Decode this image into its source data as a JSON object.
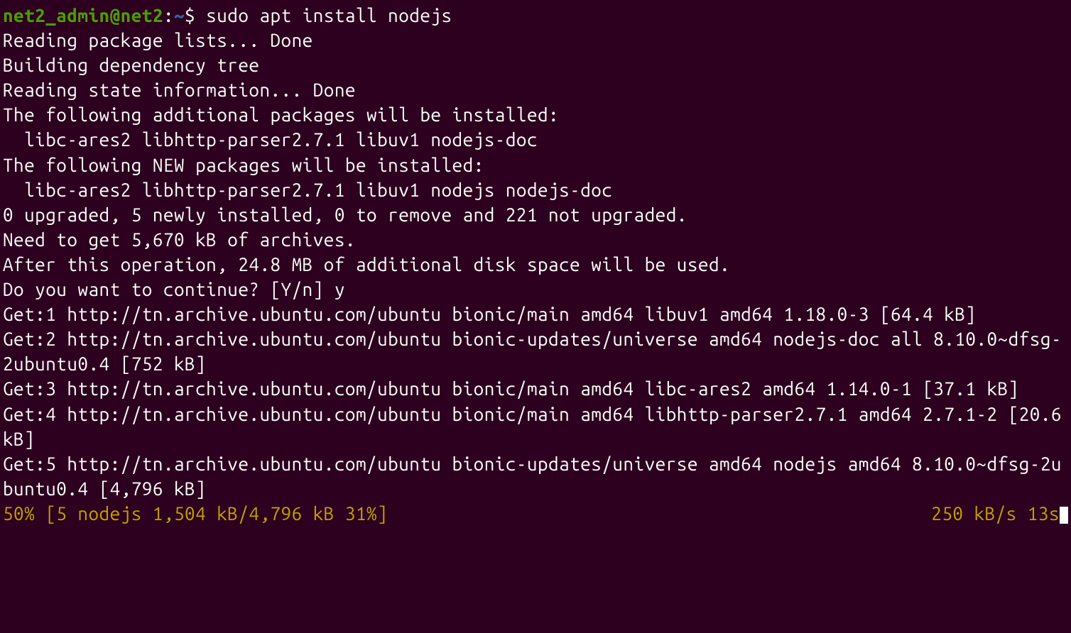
{
  "prompt": {
    "user_host": "net2_admin@net2",
    "separator": ":",
    "path": "~",
    "dollar": "$ "
  },
  "command": "sudo apt install nodejs",
  "output_lines": [
    "Reading package lists... Done",
    "Building dependency tree",
    "Reading state information... Done",
    "The following additional packages will be installed:",
    "  libc-ares2 libhttp-parser2.7.1 libuv1 nodejs-doc",
    "The following NEW packages will be installed:",
    "  libc-ares2 libhttp-parser2.7.1 libuv1 nodejs nodejs-doc",
    "0 upgraded, 5 newly installed, 0 to remove and 221 not upgraded.",
    "Need to get 5,670 kB of archives.",
    "After this operation, 24.8 MB of additional disk space will be used.",
    "Do you want to continue? [Y/n] y",
    "Get:1 http://tn.archive.ubuntu.com/ubuntu bionic/main amd64 libuv1 amd64 1.18.0-3 [64.4 kB]",
    "Get:2 http://tn.archive.ubuntu.com/ubuntu bionic-updates/universe amd64 nodejs-doc all 8.10.0~dfsg-2ubuntu0.4 [752 kB]",
    "Get:3 http://tn.archive.ubuntu.com/ubuntu bionic/main amd64 libc-ares2 amd64 1.14.0-1 [37.1 kB]",
    "Get:4 http://tn.archive.ubuntu.com/ubuntu bionic/main amd64 libhttp-parser2.7.1 amd64 2.7.1-2 [20.6 kB]",
    "Get:5 http://tn.archive.ubuntu.com/ubuntu bionic-updates/universe amd64 nodejs amd64 8.10.0~dfsg-2ubuntu0.4 [4,796 kB]"
  ],
  "progress": {
    "left": "50% [5 nodejs 1,504 kB/4,796 kB 31%]",
    "right": "250 kB/s 13s"
  }
}
